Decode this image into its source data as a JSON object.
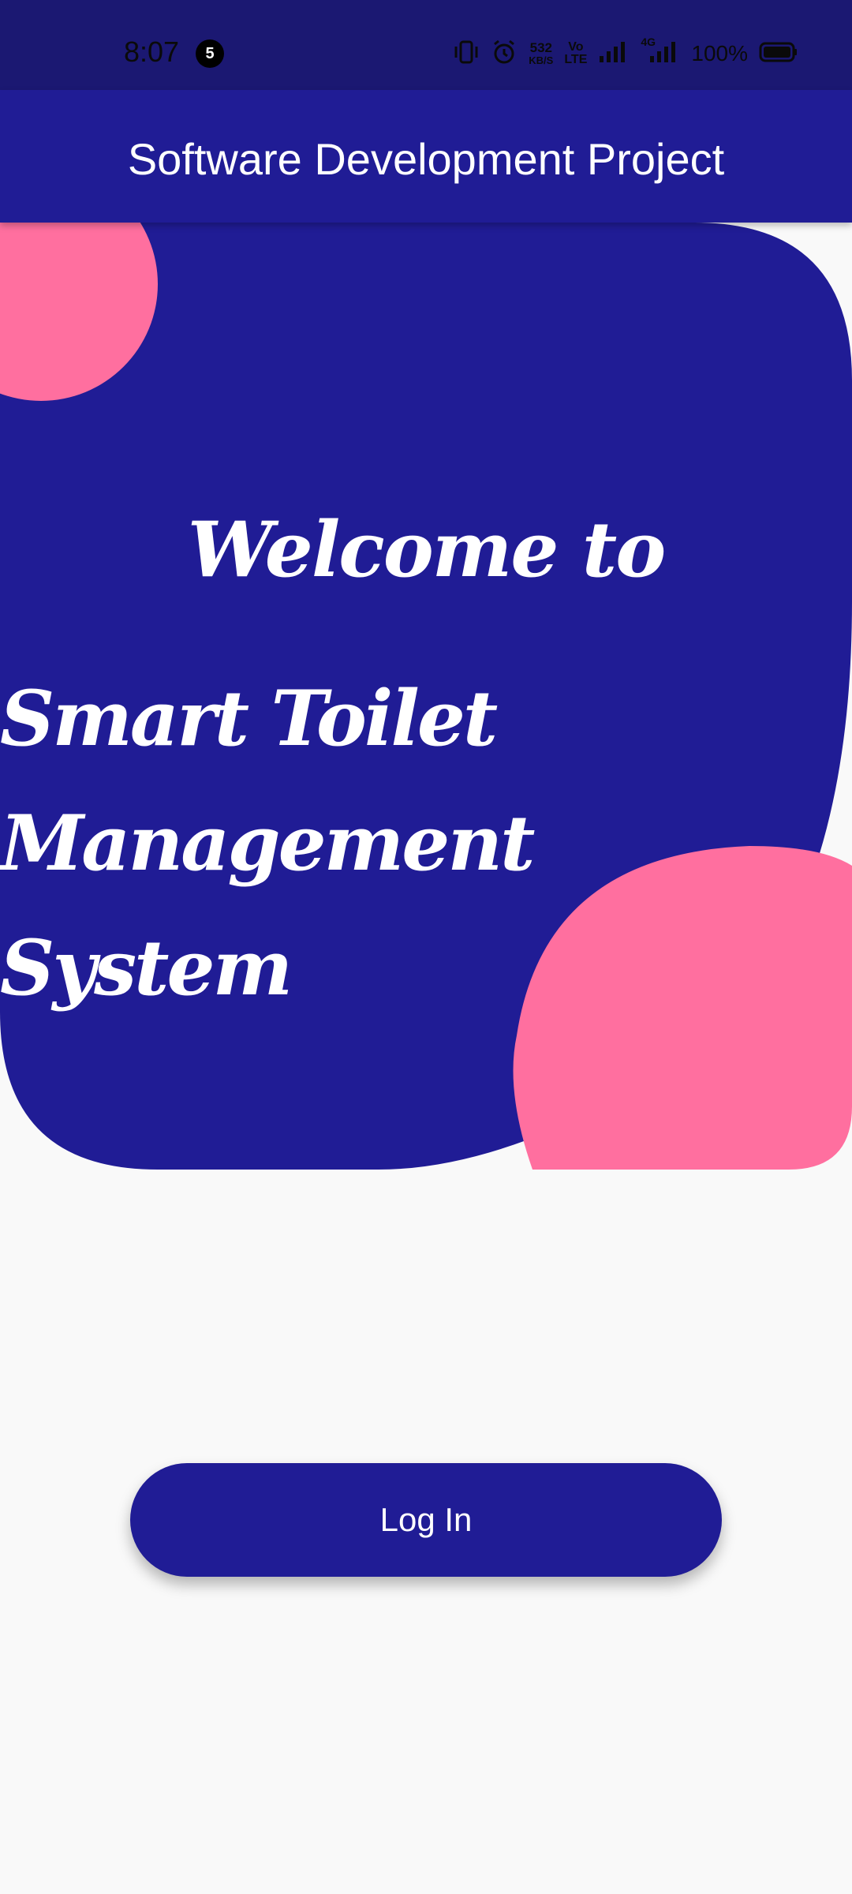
{
  "status_bar": {
    "time": "8:07",
    "notification_count": "5",
    "speed_value": "532",
    "speed_unit": "KB/S",
    "volte_top": "Vo",
    "volte_bottom": "LTE",
    "network_type": "4G",
    "battery_percent": "100%"
  },
  "app_bar": {
    "title": "Software Development Project"
  },
  "hero": {
    "welcome_text": "Welcome to",
    "system_name": "Smart Toilet Management System"
  },
  "actions": {
    "login_label": "Log In"
  },
  "colors": {
    "status_bar": "#1b1872",
    "primary": "#201c95",
    "accent_pink": "#ff6f9f",
    "background": "#f9f9f9"
  }
}
